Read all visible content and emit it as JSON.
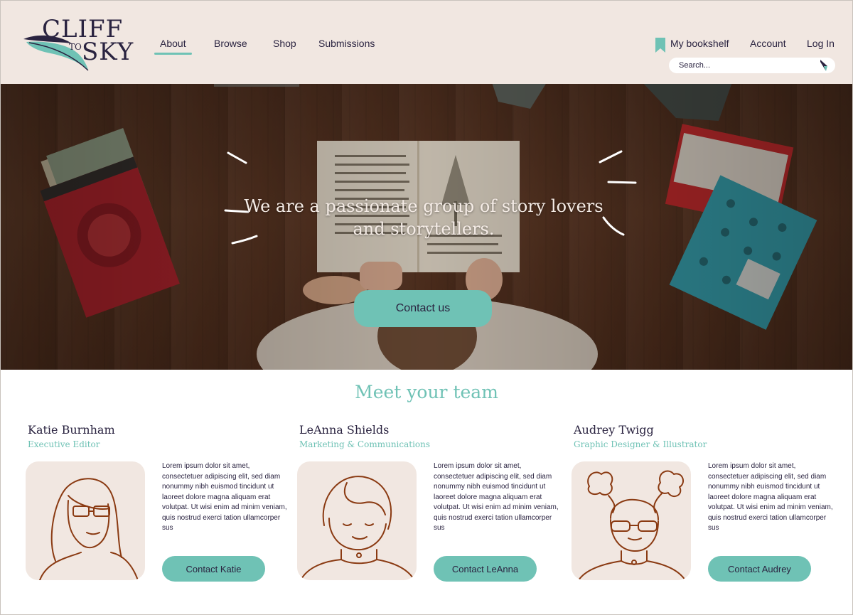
{
  "brand": {
    "logo_top": "CLIFF",
    "logo_middle": "TO",
    "logo_bottom": "SKY",
    "accent_color": "#6fc2b5",
    "header_bg": "#f1e7e1",
    "text_color": "#2a2340"
  },
  "nav": {
    "items": [
      {
        "label": "About",
        "active": true
      },
      {
        "label": "Browse",
        "active": false
      },
      {
        "label": "Shop",
        "active": false
      },
      {
        "label": "Submissions",
        "active": false
      }
    ]
  },
  "utility": {
    "bookshelf_label": "My bookshelf",
    "bookshelf_icon": "bookmark-icon",
    "account_label": "Account",
    "login_label": "Log In"
  },
  "search": {
    "placeholder": "Search...",
    "icon": "search-arrow-icon"
  },
  "hero": {
    "heading": "We are a passionate group of story lovers and storytellers.",
    "cta_label": "Contact us"
  },
  "team": {
    "title": "Meet your team",
    "members": [
      {
        "name": "Katie Burnham",
        "role": "Executive Editor",
        "bio": "Lorem ipsum dolor sit amet, consectetuer adipiscing elit, sed diam nonummy nibh euismod tincidunt ut laoreet dolore magna aliquam erat volutpat. Ut wisi enim ad minim veniam, quis nostrud exerci tation ullamcorper sus",
        "button_label": "Contact Katie"
      },
      {
        "name": "LeAnna Shields",
        "role": "Marketing & Communications",
        "bio": "Lorem ipsum dolor sit amet, consectetuer adipiscing elit, sed diam nonummy nibh euismod tincidunt ut laoreet dolore magna aliquam erat volutpat. Ut wisi enim ad minim veniam, quis nostrud exerci tation ullamcorper sus",
        "button_label": "Contact LeAnna"
      },
      {
        "name": "Audrey Twigg",
        "role": "Graphic Designer & Illustrator",
        "bio": "Lorem ipsum dolor sit amet, consectetuer adipiscing elit, sed diam nonummy nibh euismod tincidunt ut laoreet dolore magna aliquam erat volutpat. Ut wisi enim ad minim veniam, quis nostrud exerci tation ullamcorper sus",
        "button_label": "Contact Audrey"
      }
    ]
  }
}
